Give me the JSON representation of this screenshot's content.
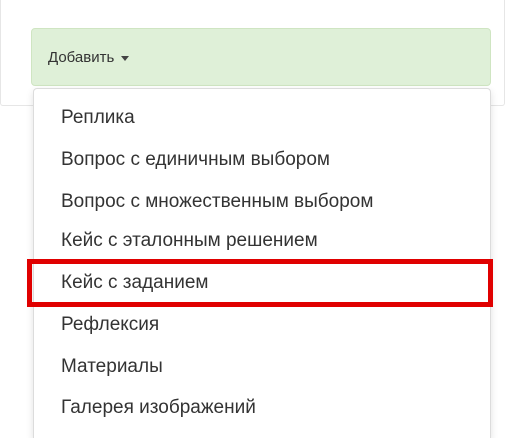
{
  "toolbar": {
    "add_label": "Добавить"
  },
  "menu": {
    "items": [
      {
        "label": "Реплика"
      },
      {
        "label": "Вопрос с единичным выбором"
      },
      {
        "label": "Вопрос с множественным выбором"
      },
      {
        "label": "Кейс с эталонным решением"
      },
      {
        "label": "Кейс с заданием",
        "highlighted": true
      },
      {
        "label": "Рефлексия"
      },
      {
        "label": "Материалы"
      },
      {
        "label": "Галерея изображений"
      }
    ]
  },
  "colors": {
    "button_bg": "#dff0d8",
    "highlight": "#e00000",
    "text": "#333333"
  },
  "icons": {
    "dropdown_caret": "caret-down-icon"
  }
}
